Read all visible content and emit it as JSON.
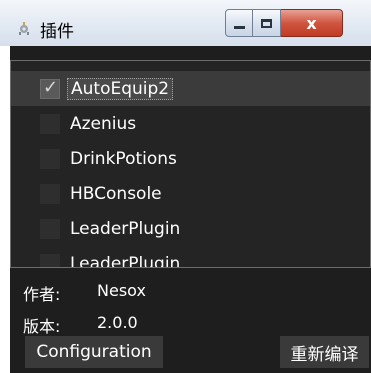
{
  "window": {
    "title": "插件",
    "close_glyph": "x"
  },
  "plugins": {
    "items": [
      {
        "label": "AutoEquip2",
        "checked": true,
        "selected": true
      },
      {
        "label": "Azenius",
        "checked": false,
        "selected": false
      },
      {
        "label": "DrinkPotions",
        "checked": false,
        "selected": false
      },
      {
        "label": "HBConsole",
        "checked": false,
        "selected": false
      },
      {
        "label": "LeaderPlugin",
        "checked": false,
        "selected": false
      },
      {
        "label": "LeaderPlugin",
        "checked": false,
        "selected": false
      }
    ]
  },
  "info": {
    "author_label": "作者:",
    "author_value": "Nesox",
    "version_label": "版本:",
    "version_value": "2.0.0"
  },
  "buttons": {
    "configuration": "Configuration",
    "recompile": "重新编译"
  },
  "icons": {
    "app": "plugin-gear-icon",
    "check": "✓"
  },
  "colors": {
    "background": "#1e1e1e",
    "list_background": "#242424",
    "selected_row": "#3b3b3b",
    "text": "#ffffff",
    "close_button": "#c8442d"
  }
}
